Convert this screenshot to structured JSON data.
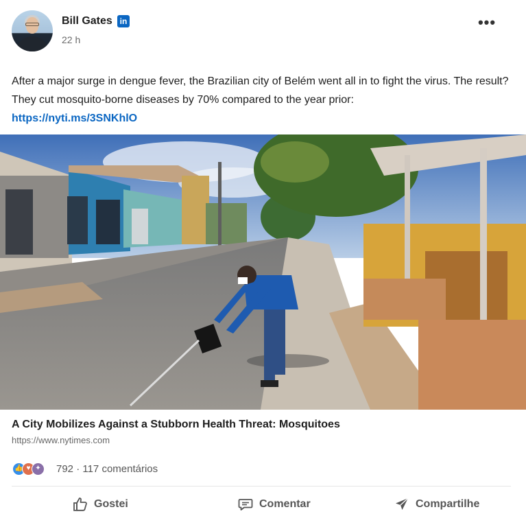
{
  "post": {
    "author": "Bill Gates",
    "network_badge": "in",
    "time": "22 h",
    "more_icon": "more-horizontal-icon",
    "text": "After a major surge in dengue fever, the Brazilian city of Belém went all in to fight the virus. The result? They cut mosquito-borne diseases by 70% compared to the year prior:",
    "link": "https://nyti.ms/3SNKhlO"
  },
  "article": {
    "title": "A City Mobilizes Against a Stubborn Health Threat: Mosquitoes",
    "url": "https://www.nytimes.com"
  },
  "social": {
    "reaction_icons": [
      "like-icon",
      "love-icon",
      "celebrate-icon"
    ],
    "summary": "792 · 117 comentários"
  },
  "actions": {
    "like": "Gostei",
    "comment": "Comentar",
    "share": "Compartilhe"
  },
  "colors": {
    "link": "#0a66c2",
    "linkedin_badge": "#0a66c2",
    "text": "#1d1d1d",
    "muted": "#666666"
  }
}
